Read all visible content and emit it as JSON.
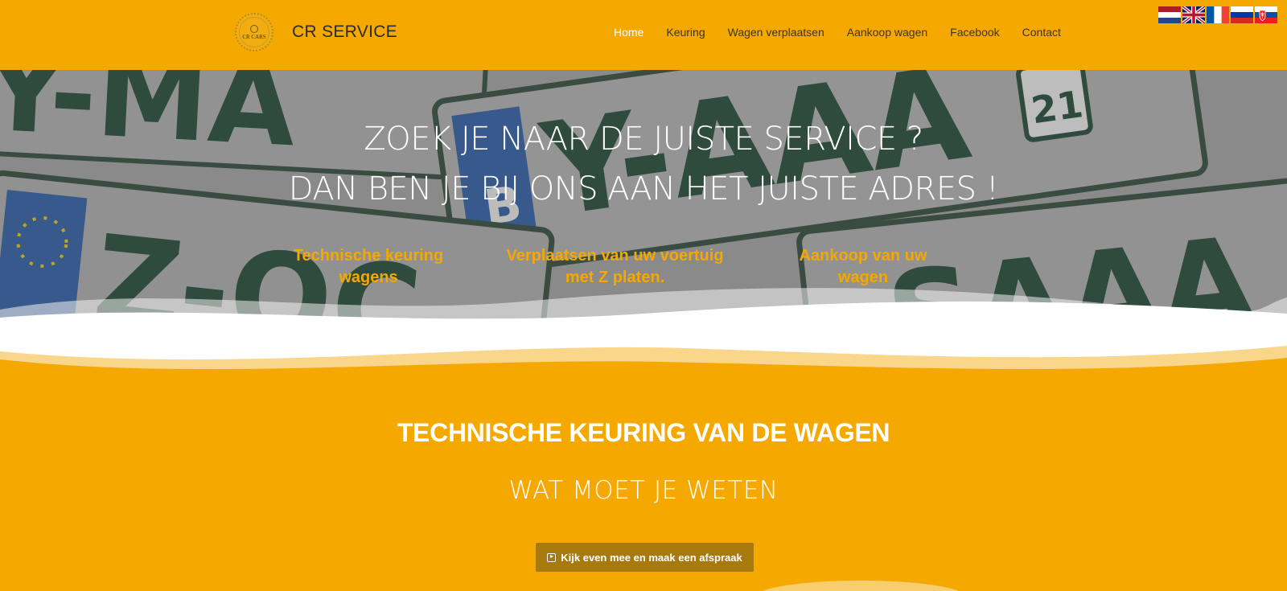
{
  "header": {
    "logo_text": "CR CARS",
    "brand": "CR SERVICE",
    "nav": [
      {
        "label": "Home",
        "active": true
      },
      {
        "label": "Keuring",
        "active": false
      },
      {
        "label": "Wagen verplaatsen",
        "active": false
      },
      {
        "label": "Aankoop wagen",
        "active": false
      },
      {
        "label": "Facebook",
        "active": false
      },
      {
        "label": "Contact",
        "active": false
      }
    ],
    "flags": [
      "nl-flag-icon",
      "uk-flag-icon",
      "fr-flag-icon",
      "ru-flag-icon",
      "sk-flag-icon"
    ]
  },
  "hero": {
    "line1": "ZOEK JE NAAR DE JUISTE SERVICE ?",
    "line2": "DAN BEN JE BIJ ONS AAN HET JUISTE ADRES !",
    "features": [
      {
        "line1": "Technische keuring",
        "line2": "wagens"
      },
      {
        "line1": "Verplaatsen van uw voertuig",
        "line2": "met Z platen."
      },
      {
        "line1": "Aankoop van uw",
        "line2": "wagen"
      }
    ]
  },
  "section": {
    "title": "TECHNISCHE KEURING VAN DE WAGEN",
    "subtitle": "WAT MOET JE WETEN",
    "cta": "Kijk even mee en maak een afspraak"
  },
  "colors": {
    "brand_orange": "#f5a800",
    "button_brown": "#a8790d",
    "active_nav": "#ffffff"
  }
}
